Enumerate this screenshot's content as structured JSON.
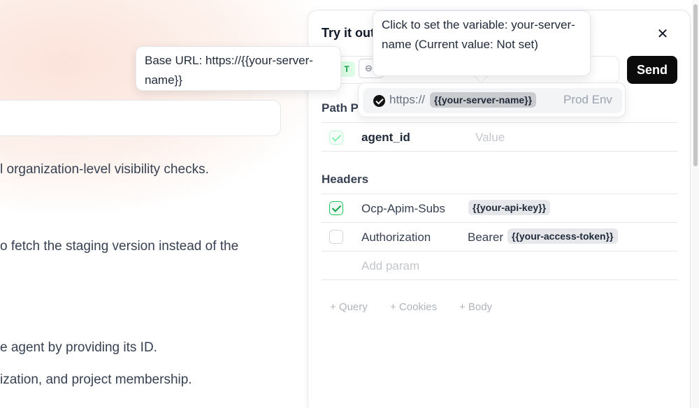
{
  "docs": {
    "line1": "l organization-level visibility checks.",
    "line2": "o fetch the staging version instead of the",
    "line3": "e agent by providing its ID.",
    "line4": "ization, and project membership."
  },
  "tooltips": {
    "base_url": "Base URL: https://{{your-server-name}}",
    "variable": "Click to set the variable: your-server-name (Current value: Not set)"
  },
  "panel": {
    "title": "Try it out",
    "close_icon": "close-icon",
    "method": "T",
    "send_label": "Send",
    "url_dropdown": {
      "prefix": "https://",
      "variable": "{{your-server-name}}",
      "env": "Prod Env"
    },
    "path_params": {
      "title": "Path Pa",
      "rows": [
        {
          "key": "agent_id",
          "value_placeholder": "Value",
          "checked": true
        }
      ]
    },
    "headers": {
      "title": "Headers",
      "rows": [
        {
          "key": "Ocp-Apim-Subs",
          "value_chip": "{{your-api-key}}",
          "checked": true
        },
        {
          "key": "Authorization",
          "value_prefix": "Bearer",
          "value_chip": "{{your-access-token}}",
          "checked": false
        }
      ],
      "add_placeholder": "Add param"
    },
    "add_links": {
      "query": "+ Query",
      "cookies": "+ Cookies",
      "body": "+ Body"
    }
  }
}
